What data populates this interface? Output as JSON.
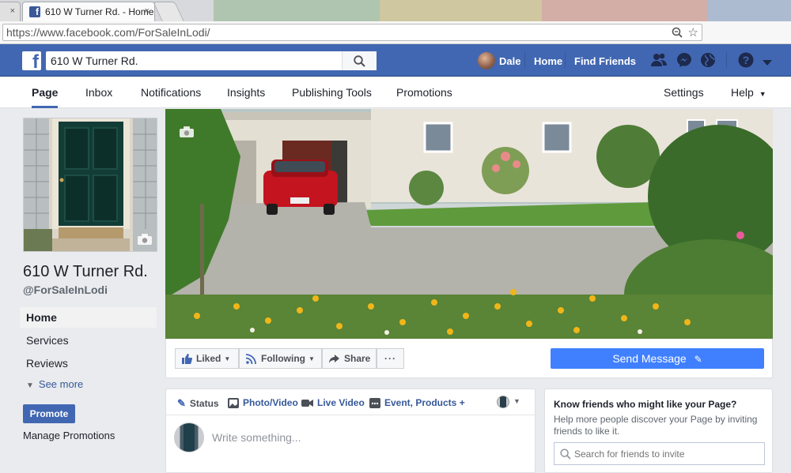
{
  "browser": {
    "tab_title": "610 W Turner Rd. - Home",
    "url": "https://www.facebook.com/ForSaleInLodi/",
    "tab_close": "×"
  },
  "topbar": {
    "logo": "f",
    "search_value": "610 W Turner Rd.",
    "user_name": "Dale",
    "home_label": "Home",
    "find_friends_label": "Find Friends"
  },
  "page_tabs": [
    {
      "label": "Page",
      "active": true
    },
    {
      "label": "Inbox"
    },
    {
      "label": "Notifications"
    },
    {
      "label": "Insights"
    },
    {
      "label": "Publishing Tools"
    },
    {
      "label": "Promotions"
    }
  ],
  "page_tabs_right": {
    "settings": "Settings",
    "help": "Help"
  },
  "profile": {
    "name": "610 W Turner Rd.",
    "handle": "@ForSaleInLodi"
  },
  "left_nav": [
    {
      "label": "Home",
      "active": true
    },
    {
      "label": "Services"
    },
    {
      "label": "Reviews"
    }
  ],
  "see_more": "See more",
  "promote_button": "Promote",
  "manage_promotions": "Manage Promotions",
  "actions": {
    "liked": "Liked",
    "following": "Following",
    "share": "Share",
    "more": "···",
    "send_message": "Send Message"
  },
  "composer": {
    "tabs": [
      "Status",
      "Photo/Video",
      "Live Video",
      "Event, Products +"
    ],
    "placeholder": "Write something..."
  },
  "invite_box": {
    "title": "Know friends who might like your Page?",
    "text": "Help more people discover your Page by inviting friends to like it.",
    "search_placeholder": "Search for friends to invite"
  },
  "colors": {
    "fb_blue": "#4267b2",
    "send_message_blue": "#4080ff",
    "link_blue": "#365899"
  }
}
